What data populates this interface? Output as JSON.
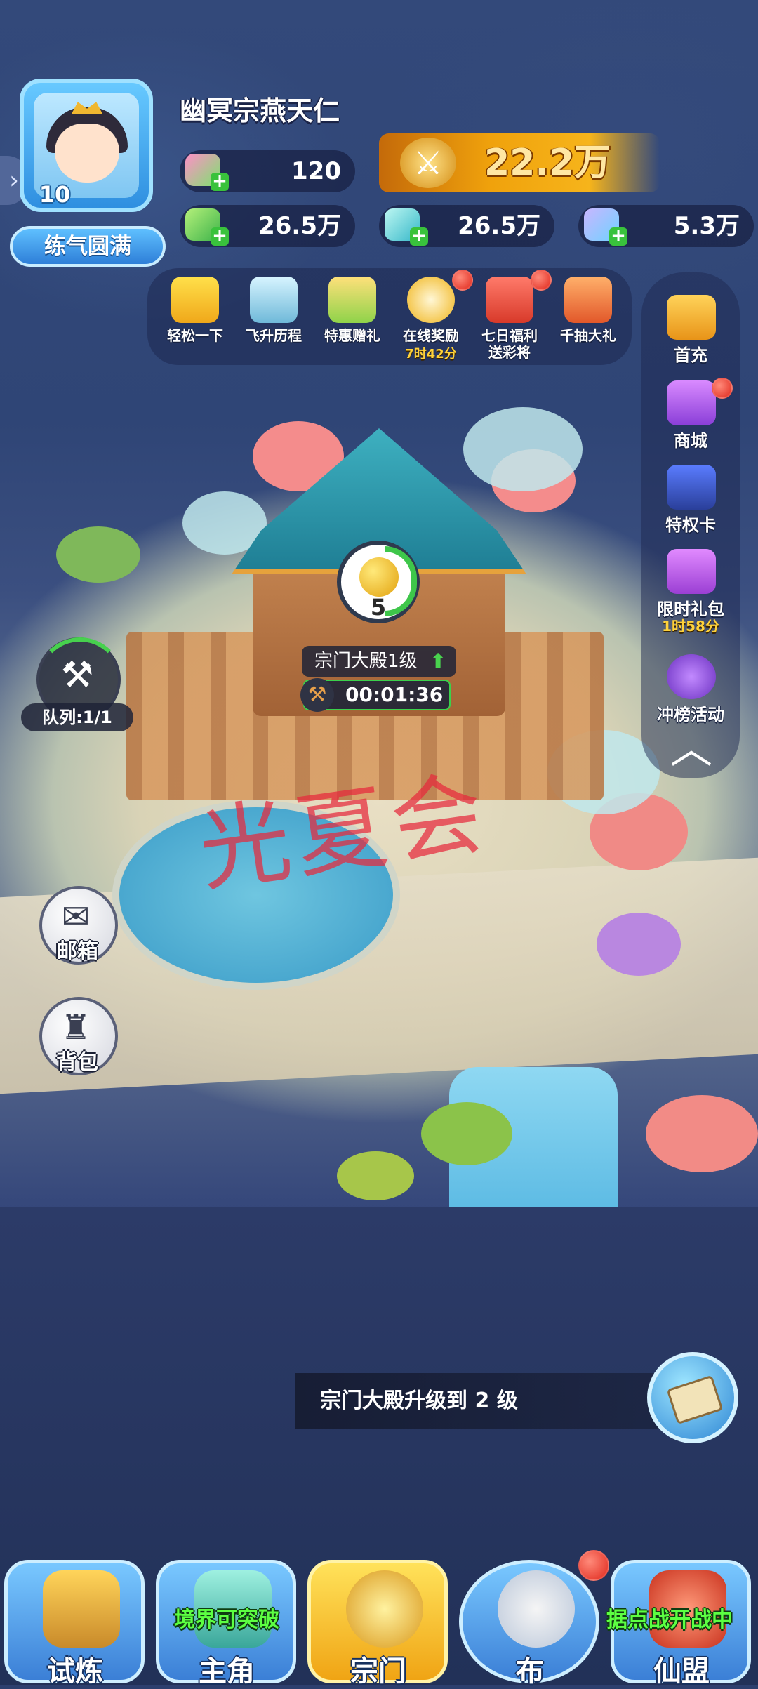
{
  "player": {
    "name": "幽冥宗燕天仁",
    "level": "10",
    "realm": "练气圆满"
  },
  "resources": {
    "power": "22.2万",
    "gem_pink": "120",
    "res_green": "26.5万",
    "res_cyan": "26.5万",
    "res_crystal": "5.3万"
  },
  "activities": [
    {
      "label": "轻松一下",
      "timer": "",
      "icon": "gamepad-icon"
    },
    {
      "label": "飞升历程",
      "timer": "",
      "icon": "mountain-icon"
    },
    {
      "label": "特惠赠礼",
      "timer": "",
      "icon": "gift-box-icon"
    },
    {
      "label": "在线奖励",
      "timer": "7时42分",
      "icon": "alarm-clock-icon"
    },
    {
      "label": "七日福利",
      "label2": "送彩将",
      "timer": "",
      "icon": "calendar-icon"
    },
    {
      "label": "千抽大礼",
      "timer": "",
      "icon": "gift-chest-icon"
    }
  ],
  "right_menu": [
    {
      "label": "首充",
      "timer": "",
      "icon": "treasure-icon"
    },
    {
      "label": "商城",
      "timer": "",
      "icon": "shop-gift-icon"
    },
    {
      "label": "特权卡",
      "timer": "",
      "icon": "star-card-icon"
    },
    {
      "label": "限时礼包",
      "timer": "1时58分",
      "icon": "purple-chest-icon"
    },
    {
      "label": "冲榜活动",
      "timer": "",
      "icon": "ranking-mask-icon"
    }
  ],
  "map": {
    "build_count": "5",
    "hall_label": "宗门大殿1级",
    "upgrade_timer": "00:01:36",
    "queue_label": "队列:1/1",
    "mail_label": "邮箱",
    "bag_label": "背包",
    "watermark": "光夏会"
  },
  "task": {
    "text": "宗门大殿升级到 2 级"
  },
  "bottom_nav": [
    {
      "label": "试炼",
      "tag": "",
      "active": false
    },
    {
      "label": "主角",
      "tag": "境界可突破",
      "active": false
    },
    {
      "label": "宗门",
      "tag": "",
      "active": true
    },
    {
      "label": "布",
      "tag": "",
      "active": false
    },
    {
      "label": "仙盟",
      "tag": "据点战开战中",
      "active": false
    }
  ],
  "colors": {
    "accent_gold": "#f6b41b",
    "plus_green": "#39c23c",
    "alert_red": "#e0281c",
    "tag_green": "#5cff42"
  }
}
